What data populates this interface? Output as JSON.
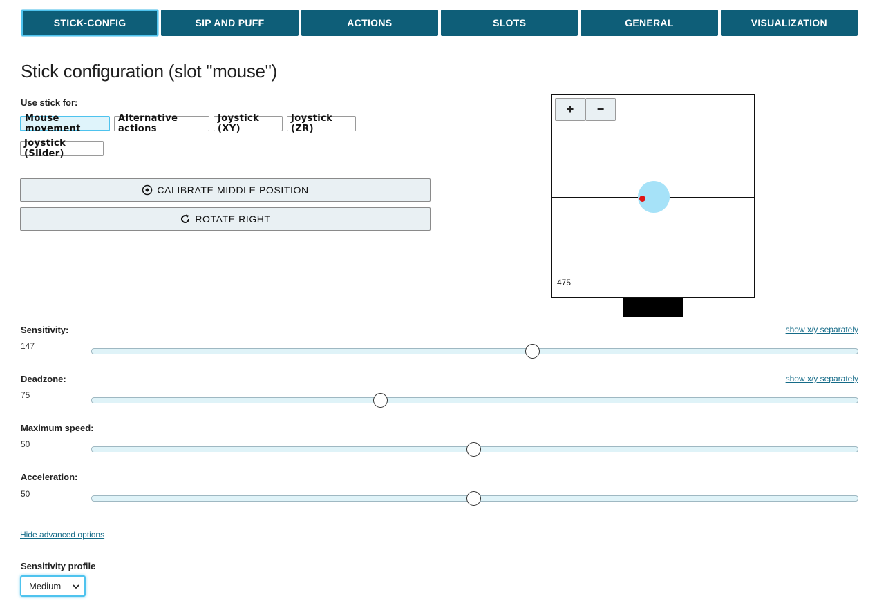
{
  "tabs": [
    {
      "label": "STICK-CONFIG",
      "active": true
    },
    {
      "label": "SIP AND PUFF",
      "active": false
    },
    {
      "label": "ACTIONS",
      "active": false
    },
    {
      "label": "SLOTS",
      "active": false
    },
    {
      "label": "GENERAL",
      "active": false
    },
    {
      "label": "VISUALIZATION",
      "active": false
    }
  ],
  "page_title": "Stick configuration (slot \"mouse\")",
  "use_stick_label": "Use stick for:",
  "modes": [
    {
      "label": "Mouse movement",
      "active": true
    },
    {
      "label": "Alternative actions",
      "active": false
    },
    {
      "label": "Joystick (XY)",
      "active": false
    },
    {
      "label": "Joystick (ZR)",
      "active": false
    },
    {
      "label": "Joystick (Slider)",
      "active": false
    }
  ],
  "calibrate_label": "CALIBRATE MIDDLE POSITION",
  "rotate_label": "ROTATE RIGHT",
  "visualization": {
    "zoom_in": "+",
    "zoom_out": "−",
    "value": "475"
  },
  "sliders": [
    {
      "label": "Sensitivity:",
      "value": "147",
      "fraction": 0.575,
      "link": "show x/y separately"
    },
    {
      "label": "Deadzone:",
      "value": "75",
      "fraction": 0.377,
      "link": "show x/y separately"
    },
    {
      "label": "Maximum speed:",
      "value": "50",
      "fraction": 0.499,
      "link": ""
    },
    {
      "label": "Acceleration:",
      "value": "50",
      "fraction": 0.499,
      "link": ""
    }
  ],
  "hide_advanced": "Hide advanced options",
  "sensitivity_profile_label": "Sensitivity profile",
  "sensitivity_profile_value": "Medium",
  "colors": {
    "tab_bg": "#0e5e78",
    "accent": "#4ec3ee",
    "stick_circle": "#a6e2f8",
    "stick_dot": "#e01515"
  }
}
